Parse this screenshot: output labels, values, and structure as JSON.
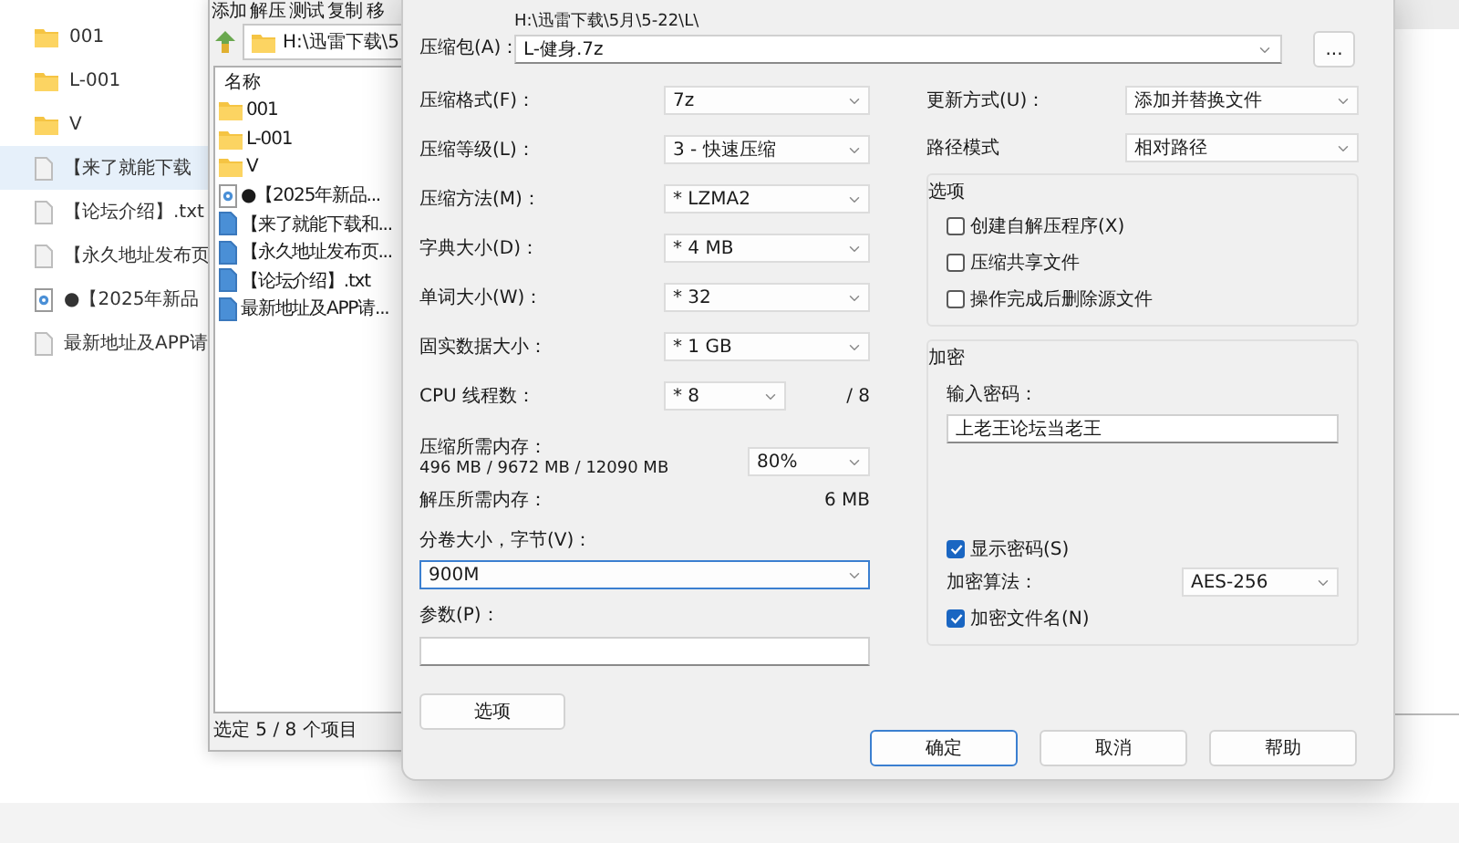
{
  "explorer": {
    "items": [
      {
        "name": "001",
        "kind": "folder",
        "selected": false
      },
      {
        "name": "L-001",
        "kind": "folder",
        "selected": false
      },
      {
        "name": "V",
        "kind": "folder",
        "selected": false
      },
      {
        "name": "【来了就能下载",
        "kind": "document",
        "selected": true
      },
      {
        "name": "【论坛介绍】.txt",
        "kind": "document",
        "selected": false
      },
      {
        "name": "【永久地址发布页",
        "kind": "document",
        "selected": false
      },
      {
        "name": "●【2025年新品",
        "kind": "media",
        "selected": false
      },
      {
        "name": "最新地址及APP请",
        "kind": "document",
        "selected": false
      }
    ]
  },
  "file_manager": {
    "menu": [
      "添加",
      "解压",
      "测试",
      "复制",
      "移"
    ],
    "path": "H:\\迅雷下载\\5",
    "column": "名称",
    "items": [
      {
        "name": "001",
        "kind": "folder"
      },
      {
        "name": "L-001",
        "kind": "folder"
      },
      {
        "name": "V",
        "kind": "folder"
      },
      {
        "name": "●【2025年新品...",
        "kind": "media"
      },
      {
        "name": "【来了就能下载和...",
        "kind": "document"
      },
      {
        "name": "【永久地址发布页...",
        "kind": "document"
      },
      {
        "name": "【论坛介绍】.txt",
        "kind": "document"
      },
      {
        "name": "最新地址及APP请...",
        "kind": "document"
      }
    ],
    "status": "选定 5 / 8 个项目"
  },
  "dialog": {
    "archive": {
      "label": "压缩包(A)：",
      "folder": "H:\\迅雷下载\\5月\\5-22\\L\\",
      "value": "L-健身.7z"
    },
    "browse_button": "...",
    "left_fields": [
      {
        "label": "压缩格式(F)：",
        "value": "7z",
        "kind": "combo"
      },
      {
        "label": "压缩等级(L)：",
        "value": "3 - 快速压缩",
        "kind": "combo"
      },
      {
        "label": "压缩方法(M)：",
        "value": "* LZMA2",
        "kind": "combo"
      },
      {
        "label": "字典大小(D)：",
        "value": "* 4 MB",
        "kind": "combo"
      },
      {
        "label": "单词大小(W)：",
        "value": "* 32",
        "kind": "combo"
      },
      {
        "label": "固实数据大小：",
        "value": "* 1 GB",
        "kind": "combo"
      },
      {
        "label": "CPU 线程数：",
        "value": "* 8",
        "suffix": "/ 8",
        "kind": "short"
      }
    ],
    "memory": {
      "label": "压缩所需内存：",
      "detail": "496 MB / 9672 MB / 12090 MB",
      "value": "80%"
    },
    "decompress_memory": {
      "label": "解压所需内存：",
      "value": "6 MB"
    },
    "volume": {
      "label": "分卷大小，字节(V)：",
      "value": "900M"
    },
    "params": {
      "label": "参数(P)："
    },
    "options_button": "选项",
    "right_fields": [
      {
        "label": "更新方式(U)：",
        "value": "添加并替换文件"
      },
      {
        "label": "路径模式",
        "value": "相对路径"
      }
    ],
    "options_group": {
      "title": "选项",
      "checkboxes": [
        {
          "label": "创建自解压程序(X)",
          "checked": false
        },
        {
          "label": "压缩共享文件",
          "checked": false
        },
        {
          "label": "操作完成后删除源文件",
          "checked": false
        }
      ]
    },
    "encryption": {
      "title": "加密",
      "password_label": "输入密码：",
      "password": "上老王论坛当老王",
      "show_password": {
        "label": "显示密码(S)",
        "checked": true
      },
      "method_label": "加密算法：",
      "method": "AES-256",
      "encrypt_names": {
        "label": "加密文件名(N)",
        "checked": true
      }
    },
    "buttons": [
      {
        "label": "确定",
        "focused": true
      },
      {
        "label": "取消",
        "focused": false
      },
      {
        "label": "帮助",
        "focused": false
      }
    ]
  }
}
